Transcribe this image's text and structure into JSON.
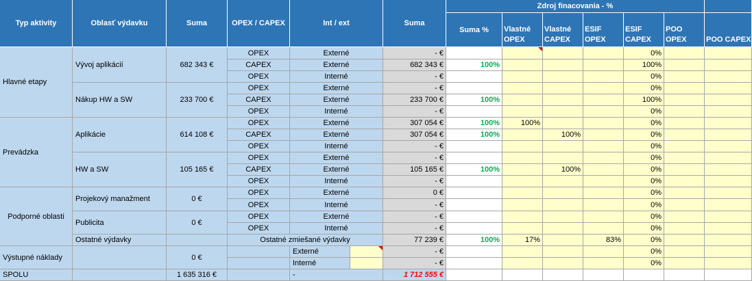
{
  "header": {
    "typ_aktivity": "Typ aktivity",
    "oblast_vydavku": "Oblasť výdavku",
    "suma": "Suma",
    "opex_capex": "OPEX / CAPEX",
    "int_ext": "Int / ext",
    "suma2": "Suma",
    "zdroj": "Zdroj finacovania - %",
    "suma_pct": "Suma %",
    "vlastne_opex": "Vlastné OPEX",
    "vlastne_capex": "Vlastné CAPEX",
    "esif_opex": "ESIF OPEX",
    "esif_capex": "ESIF CAPEX",
    "poo_opex": "POO OPEX",
    "poo_capex": "POO CAPEX"
  },
  "groups": {
    "hlavne": "Hlavné etapy",
    "prevadzka": "Prevádzka",
    "podporne": "Podporné oblasti",
    "vystupne": "Výstupné náklady",
    "spolu": "SPOLU"
  },
  "areas": {
    "vyvoj": {
      "name": "Vývoj aplikácií",
      "sum": "682 343 €"
    },
    "nakup": {
      "name": "Nákup HW a SW",
      "sum": "233 700 €"
    },
    "aplikacie": {
      "name": "Aplikácie",
      "sum": "614 108 €"
    },
    "hwsw": {
      "name": "HW a SW",
      "sum": "105 165 €"
    },
    "projekt": {
      "name": "Projekový manažment",
      "sum": "0 €"
    },
    "publicita": {
      "name": "Publicita",
      "sum": "0 €"
    },
    "ostatne": {
      "name": "Ostatné výdavky",
      "type": "Ostatné zmiešané výdavky"
    },
    "vystupne": {
      "sum": "0 €"
    }
  },
  "rows": [
    {
      "type": "OPEX",
      "ie": "Externé",
      "sum": "- €",
      "pct": "",
      "vo": "",
      "vc": "",
      "eo": "",
      "ec": "0%"
    },
    {
      "type": "CAPEX",
      "ie": "Externé",
      "sum": "682 343 €",
      "pct": "100%",
      "vo": "",
      "vc": "",
      "eo": "",
      "ec": "100%"
    },
    {
      "type": "OPEX",
      "ie": "Interné",
      "sum": "- €",
      "pct": "",
      "vo": "",
      "vc": "",
      "eo": "",
      "ec": "0%"
    },
    {
      "type": "OPEX",
      "ie": "Externé",
      "sum": "- €",
      "pct": "",
      "vo": "",
      "vc": "",
      "eo": "",
      "ec": "0%"
    },
    {
      "type": "CAPEX",
      "ie": "Externé",
      "sum": "233 700 €",
      "pct": "100%",
      "vo": "",
      "vc": "",
      "eo": "",
      "ec": "100%"
    },
    {
      "type": "OPEX",
      "ie": "Interné",
      "sum": "- €",
      "pct": "",
      "vo": "",
      "vc": "",
      "eo": "",
      "ec": "0%"
    },
    {
      "type": "OPEX",
      "ie": "Externé",
      "sum": "307 054 €",
      "pct": "100%",
      "vo": "100%",
      "vc": "",
      "eo": "",
      "ec": "0%"
    },
    {
      "type": "CAPEX",
      "ie": "Externé",
      "sum": "307 054 €",
      "pct": "100%",
      "vo": "",
      "vc": "100%",
      "eo": "",
      "ec": "0%"
    },
    {
      "type": "OPEX",
      "ie": "Interné",
      "sum": "- €",
      "pct": "",
      "vo": "",
      "vc": "",
      "eo": "",
      "ec": "0%"
    },
    {
      "type": "OPEX",
      "ie": "Externé",
      "sum": "- €",
      "pct": "",
      "vo": "",
      "vc": "",
      "eo": "",
      "ec": "0%"
    },
    {
      "type": "CAPEX",
      "ie": "Externé",
      "sum": "105 165 €",
      "pct": "100%",
      "vo": "",
      "vc": "100%",
      "eo": "",
      "ec": "0%"
    },
    {
      "type": "OPEX",
      "ie": "Interné",
      "sum": "- €",
      "pct": "",
      "vo": "",
      "vc": "",
      "eo": "",
      "ec": "0%"
    },
    {
      "type": "OPEX",
      "ie": "Externé",
      "sum": "0 €",
      "pct": "",
      "vo": "",
      "vc": "",
      "eo": "",
      "ec": "0%"
    },
    {
      "type": "OPEX",
      "ie": "Interné",
      "sum": "- €",
      "pct": "",
      "vo": "",
      "vc": "",
      "eo": "",
      "ec": "0%"
    },
    {
      "type": "OPEX",
      "ie": "Externé",
      "sum": "- €",
      "pct": "",
      "vo": "",
      "vc": "",
      "eo": "",
      "ec": "0%"
    },
    {
      "type": "OPEX",
      "ie": "Interné",
      "sum": "- €",
      "pct": "",
      "vo": "",
      "vc": "",
      "eo": "",
      "ec": "0%"
    },
    {
      "type": "",
      "ie": "",
      "sum": "77 239 €",
      "pct": "100%",
      "vo": "17%",
      "vc": "",
      "eo": "83%",
      "ec": "0%"
    },
    {
      "type": "",
      "ie": "Externé",
      "sum": "- €",
      "pct": "",
      "vo": "",
      "vc": "",
      "eo": "",
      "ec": "0%"
    },
    {
      "type": "",
      "ie": "Interné",
      "sum": "- €",
      "pct": "",
      "vo": "",
      "vc": "",
      "eo": "",
      "ec": "0%"
    }
  ],
  "total": {
    "sum": "1 635 316 €",
    "ie": "-",
    "sum2": "1 712 555 €"
  },
  "colors": {
    "header": "#2e75b6",
    "light_blue": "#bdd7ee",
    "gray": "#d9d9d9",
    "yellow": "#ffffcc",
    "green": "#00b050",
    "red": "#ff0000"
  }
}
